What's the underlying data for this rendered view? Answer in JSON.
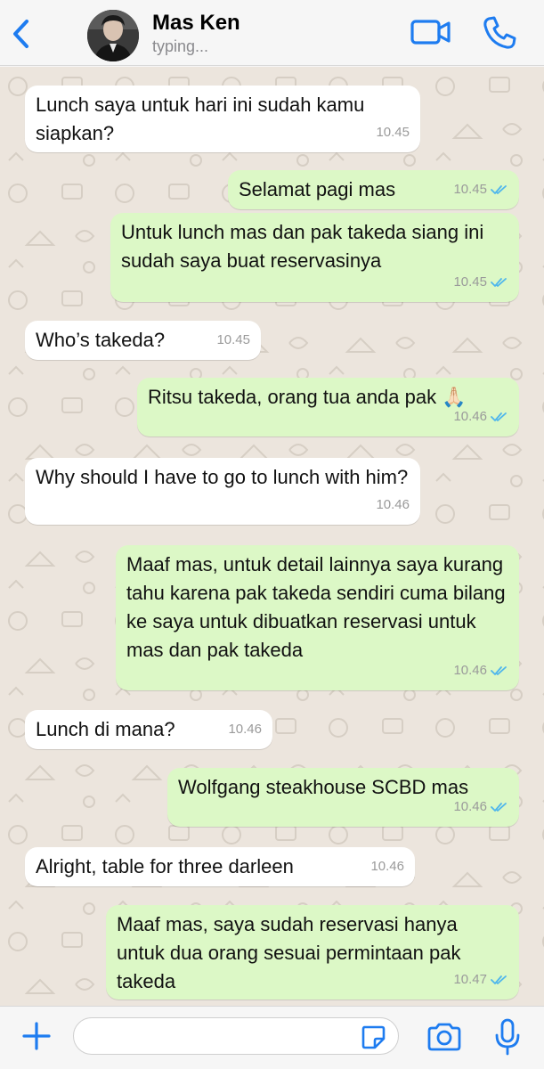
{
  "header": {
    "contact_name": "Mas Ken",
    "status": "typing...",
    "icons": [
      "chevron-left-icon",
      "video-icon",
      "phone-icon"
    ]
  },
  "colors": {
    "accent": "#1e7cf0",
    "incoming_bubble": "#ffffff",
    "outgoing_bubble": "#dcf8c6",
    "chat_background": "#ece5dd",
    "read_ticks": "#4fb6ec"
  },
  "messages": [
    {
      "direction": "in",
      "text": "Lunch saya untuk hari ini sudah kamu siapkan?",
      "time": "10.45"
    },
    {
      "direction": "out",
      "text": "Selamat pagi mas",
      "time": "10.45",
      "status": "read"
    },
    {
      "direction": "out",
      "text": "Untuk lunch mas dan pak takeda siang ini sudah saya buat reservasinya",
      "time": "10.45",
      "status": "read"
    },
    {
      "direction": "in",
      "text": "Who’s takeda?",
      "time": "10.45"
    },
    {
      "direction": "out",
      "text": "Ritsu takeda, orang tua anda pak 🙏🏻",
      "time": "10.46",
      "status": "read"
    },
    {
      "direction": "in",
      "text": "Why should I have to go to lunch with him?",
      "time": "10.46"
    },
    {
      "direction": "out",
      "text": "Maaf mas, untuk detail lainnya saya kurang tahu karena pak takeda sendiri cuma bilang ke saya untuk dibuatkan reservasi untuk mas dan pak takeda",
      "time": "10.46",
      "status": "read"
    },
    {
      "direction": "in",
      "text": "Lunch di mana?",
      "time": "10.46"
    },
    {
      "direction": "out",
      "text": "Wolfgang steakhouse SCBD mas",
      "time": "10.46",
      "status": "read"
    },
    {
      "direction": "in",
      "text": "Alright, table for three darleen",
      "time": "10.46"
    },
    {
      "direction": "out",
      "text": "Maaf mas, saya sudah reservasi hanya untuk dua orang sesuai permintaan pak takeda",
      "time": "10.47",
      "status": "read"
    }
  ],
  "input": {
    "value": "",
    "placeholder": "",
    "icons": [
      "plus-icon",
      "sticker-icon",
      "camera-icon",
      "microphone-icon"
    ]
  }
}
